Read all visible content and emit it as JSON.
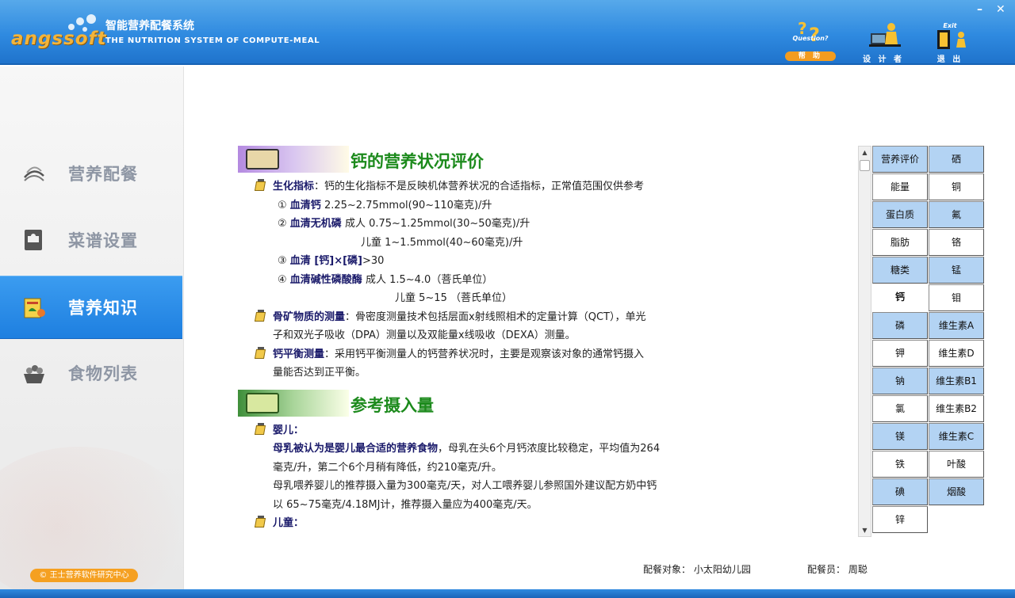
{
  "header": {
    "logo_text": "angssoft",
    "title_cn": "智能营养配餐系统",
    "subtitle_en": "THE NUTRITION SYSTEM OF COMPUTE-MEAL",
    "help": {
      "en": "Question?",
      "zh": "帮 助"
    },
    "designer": {
      "zh": "设 计 者"
    },
    "exit": {
      "en": "Exit",
      "zh": "退 出"
    },
    "minimize": "–",
    "close": "✕"
  },
  "sidebar": {
    "items": [
      {
        "label": "营养配餐",
        "icon": "hands-icon",
        "active": false
      },
      {
        "label": "菜谱设置",
        "icon": "recipe-book-icon",
        "active": false
      },
      {
        "label": "营养知识",
        "icon": "nutrition-knowledge-icon",
        "active": true
      },
      {
        "label": "食物列表",
        "icon": "food-basket-icon",
        "active": false
      }
    ],
    "copyright": "© 王士营养软件研究中心"
  },
  "content": {
    "section1": {
      "title": "钙的营养状况评价",
      "p1_label": "生化指标",
      "p1_text": "：钙的生化指标不是反映机体营养状况的合适指标，正常值范围仅供参考",
      "i1_no": "①",
      "i1_label": "血清钙",
      "i1_text": "2.25~2.75mmol(90~110毫克)/升",
      "i2_no": "②",
      "i2_label": "血清无机磷",
      "i2_text": "成人  0.75~1.25mmol(30~50毫克)/升",
      "i2_text2": "儿童  1~1.5mmol(40~60毫克)/升",
      "i3_no": "③",
      "i3_label": "血清 [钙]×[磷]",
      "i3_text": ">30",
      "i4_no": "④",
      "i4_label": "血清碱性磷酸酶",
      "i4_text": "成人  1.5~4.0（菩氏单位）",
      "i4_text2": "儿童  5~15      （菩氏单位）",
      "p2_label": "骨矿物质的测量",
      "p2_text": "：骨密度测量技术包括层面x射线照相术的定量计算（QCT），单光",
      "p2_text2": "子和双光子吸收（DPA）测量以及双能量x线吸收（DEXA）测量。",
      "p3_label": "钙平衡测量",
      "p3_text": "：采用钙平衡测量人的钙营养状况时，主要是观察该对象的通常钙摄入",
      "p3_text2": "量能否达到正平衡。"
    },
    "section2": {
      "title": "参考摄入量",
      "p1_label": "婴儿：",
      "l1_bold": "母乳被认为是婴儿最合适的营养食物",
      "l1_text": "，母乳在头6个月钙浓度比较稳定，平均值为264",
      "l2": "毫克/升，第二个6个月稍有降低，约210毫克/升。",
      "l3": "母乳喂养婴儿的推荐摄入量为300毫克/天，对人工喂养婴儿参照国外建议配方奶中钙",
      "l4": "以  65~75毫克/4.18MJ计，推荐摄入量应为400毫克/天。",
      "p2_label": "儿童："
    }
  },
  "nutrients": [
    {
      "label": "营养评价",
      "style": "blue"
    },
    {
      "label": "硒",
      "style": "blue"
    },
    {
      "label": "能量",
      "style": "white"
    },
    {
      "label": "铜",
      "style": "white"
    },
    {
      "label": "蛋白质",
      "style": "blue"
    },
    {
      "label": "氟",
      "style": "blue"
    },
    {
      "label": "脂肪",
      "style": "white"
    },
    {
      "label": "铬",
      "style": "white"
    },
    {
      "label": "糖类",
      "style": "blue"
    },
    {
      "label": "锰",
      "style": "blue"
    },
    {
      "label": "钙",
      "style": "selected"
    },
    {
      "label": "钼",
      "style": "white"
    },
    {
      "label": "磷",
      "style": "blue"
    },
    {
      "label": "维生素A",
      "style": "blue"
    },
    {
      "label": "钾",
      "style": "white"
    },
    {
      "label": "维生素D",
      "style": "white"
    },
    {
      "label": "钠",
      "style": "blue"
    },
    {
      "label": "维生素B1",
      "style": "blue"
    },
    {
      "label": "氯",
      "style": "white"
    },
    {
      "label": "维生素B2",
      "style": "white"
    },
    {
      "label": "镁",
      "style": "blue"
    },
    {
      "label": "维生素C",
      "style": "blue"
    },
    {
      "label": "铁",
      "style": "white"
    },
    {
      "label": "叶酸",
      "style": "white"
    },
    {
      "label": "碘",
      "style": "blue"
    },
    {
      "label": "烟酸",
      "style": "blue"
    },
    {
      "label": "锌",
      "style": "white"
    }
  ],
  "footer": {
    "target_label": "配餐对象：",
    "target_value": "小太阳幼儿园",
    "staff_label": "配餐员：",
    "staff_value": "周聪"
  },
  "colors": {
    "header_blue": "#2f8ae0",
    "active_nav": "#1e7fe0",
    "section_title": "#1c8a1c",
    "cell_blue": "#b3d3f3",
    "badge_orange": "#f5a021"
  }
}
